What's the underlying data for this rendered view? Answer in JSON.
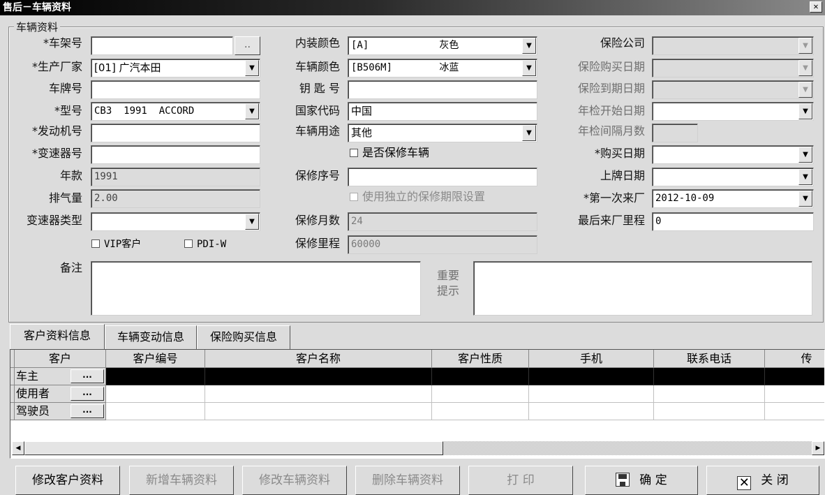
{
  "window": {
    "title": "售后－车辆资料",
    "close_glyph": "✕"
  },
  "group": {
    "legend": "车辆资料"
  },
  "labels": {
    "vin": "*车架号",
    "maker": "*生产厂家",
    "plate": "车牌号",
    "model": "*型号",
    "engine": "*发动机号",
    "gearbox": "*变速器号",
    "year": "年款",
    "displacement": "排气量",
    "gearbox_type": "变速器类型",
    "interior_color": "内装颜色",
    "vehicle_color": "车辆颜色",
    "key_no": "钥 匙 号",
    "country_code": "国家代码",
    "usage": "车辆用途",
    "warranty_seq": "保修序号",
    "warranty_months": "保修月数",
    "warranty_mileage": "保修里程",
    "insurer": "保险公司",
    "ins_buy_date": "保险购买日期",
    "ins_expire_date": "保险到期日期",
    "inspect_start": "年检开始日期",
    "inspect_interval": "年检间隔月数",
    "purchase_date": "*购买日期",
    "plate_date": "上牌日期",
    "first_visit": "*第一次来厂",
    "last_mileage": "最后来厂里程",
    "remark": "备注",
    "important_tip": "重要\n提示"
  },
  "values": {
    "vin": "",
    "maker": "[01] 广汽本田",
    "plate": "",
    "model": "CB3  1991  ACCORD",
    "engine": "",
    "gearbox": "",
    "year": "1991",
    "displacement": "2.00",
    "gearbox_type": "",
    "interior_color": "[A]            灰色",
    "vehicle_color": "[B506M]        冰蓝",
    "key_no": "",
    "country_code": "中国",
    "usage": "其他",
    "warranty_seq": "",
    "warranty_months": "24",
    "warranty_mileage": "60000",
    "insurer": "",
    "ins_buy_date": "",
    "ins_expire_date": "",
    "inspect_start": "",
    "inspect_interval": "",
    "purchase_date": "",
    "plate_date": "",
    "first_visit": "2012-10-09",
    "last_mileage": "0"
  },
  "checkboxes": {
    "warranty_vehicle": "是否保修车辆",
    "independent_warranty": "使用独立的保修期限设置",
    "vip": "VIP客户",
    "pdi": "PDI-W"
  },
  "browse_label": "..",
  "dropdown_glyph": "▼",
  "tabs": [
    "客户资料信息",
    "车辆变动信息",
    "保险购买信息"
  ],
  "grid": {
    "columns": [
      "客户",
      "客户编号",
      "客户名称",
      "客户性质",
      "手机",
      "联系电话",
      "传"
    ],
    "rows": [
      "车主",
      "使用者",
      "驾驶员"
    ],
    "row_button": "..."
  },
  "scroll": {
    "left": "◀",
    "right": "▶"
  },
  "buttons": {
    "edit_customer": "修改客户资料",
    "add_vehicle": "新增车辆资料",
    "edit_vehicle": "修改车辆资料",
    "delete_vehicle": "删除车辆资料",
    "print": "打 印",
    "ok": "确 定",
    "close": "关 闭"
  }
}
